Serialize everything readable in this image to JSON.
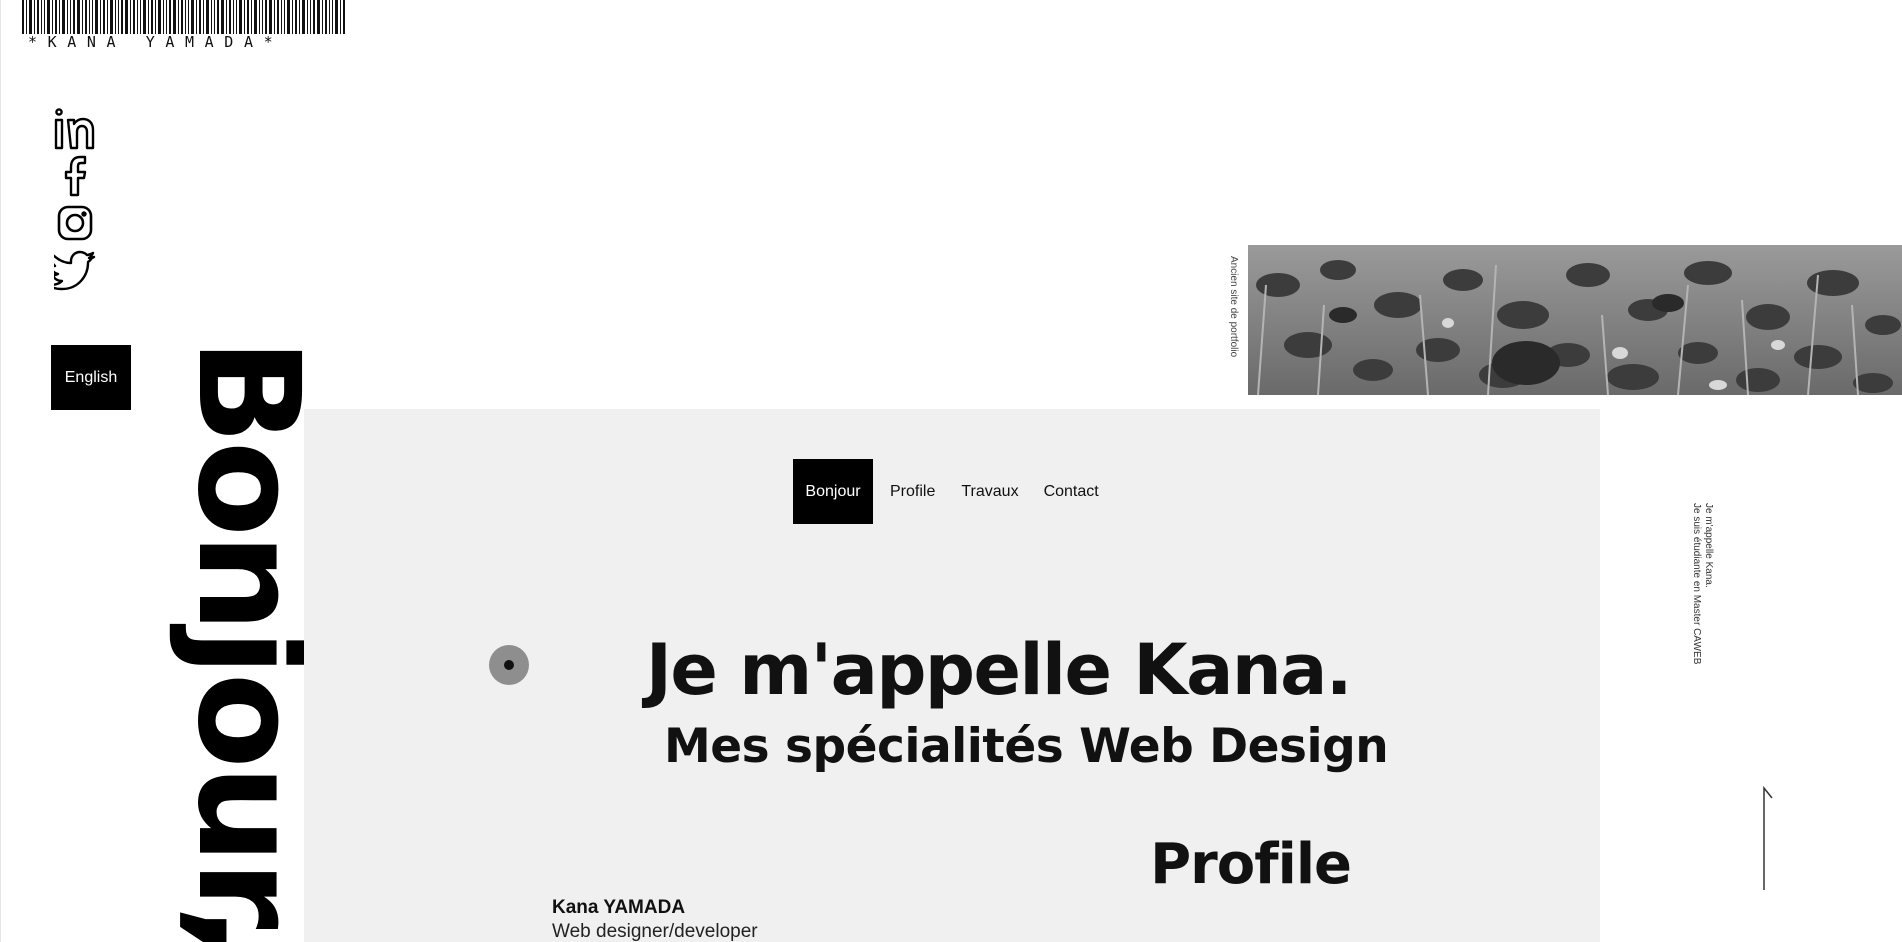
{
  "logo": {
    "text": "*KANA YAMADA*"
  },
  "socials": [
    {
      "name": "linkedin",
      "icon": "linkedin-icon"
    },
    {
      "name": "facebook",
      "icon": "facebook-icon"
    },
    {
      "name": "instagram",
      "icon": "instagram-icon"
    },
    {
      "name": "twitter",
      "icon": "twitter-icon"
    }
  ],
  "language_button": {
    "label": "English"
  },
  "side_title": "Bonjour,",
  "nav": {
    "items": [
      {
        "label": "Bonjour",
        "active": true
      },
      {
        "label": "Profile",
        "active": false
      },
      {
        "label": "Travaux",
        "active": false
      },
      {
        "label": "Contact",
        "active": false
      }
    ]
  },
  "portfolio": {
    "label": "Ancien site de portfolio"
  },
  "intro_vertical": {
    "line1": "Je m'appelle Kana.",
    "line2": "Je suis étudiante en Master CAWEB"
  },
  "hero": {
    "headline": "Je m'appelle Kana.",
    "subheadline": "Mes spécialités Web Design"
  },
  "profile": {
    "title": "Profile",
    "name": "Kana YAMADA",
    "role": "Web designer/developer"
  },
  "colors": {
    "panel_bg": "#f0f0f0",
    "accent": "#000000",
    "text": "#111111"
  }
}
